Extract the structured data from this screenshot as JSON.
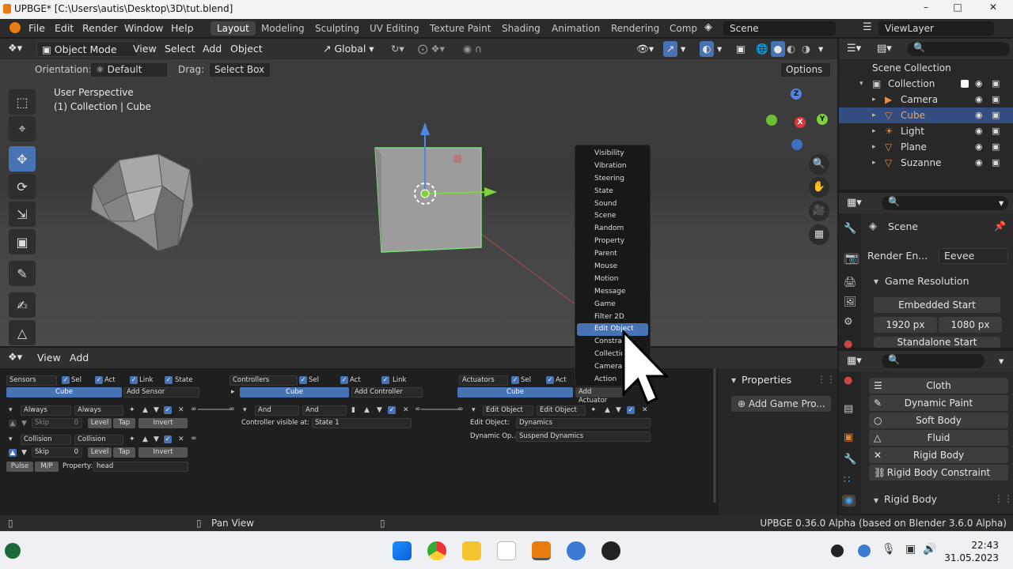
{
  "window": {
    "title": "UPBGE* [C:\\Users\\autis\\Desktop\\3D\\tut.blend]",
    "minimize": "–",
    "maximize": "□",
    "close": "✕"
  },
  "menus": [
    "File",
    "Edit",
    "Render",
    "Window",
    "Help"
  ],
  "workspaces": [
    "Layout",
    "Modeling",
    "Sculpting",
    "UV Editing",
    "Texture Paint",
    "Shading",
    "Animation",
    "Rendering",
    "Comp"
  ],
  "scene_name": "Scene",
  "view_layer": "ViewLayer",
  "viewport_header": {
    "mode": "Object Mode",
    "items": [
      "View",
      "Select",
      "Add",
      "Object"
    ],
    "transform": "Global",
    "orientation_label": "Orientation:",
    "orientation_value": "Default",
    "drag_label": "Drag:",
    "drag_value": "Select Box",
    "options": "Options"
  },
  "viewport": {
    "perspective": "User Perspective",
    "collection_info": "(1) Collection | Cube",
    "gizmo": {
      "z": "Z",
      "x": "X",
      "y": "Y"
    }
  },
  "context_menu": {
    "items": [
      "Visibility",
      "Vibration",
      "Steering",
      "State",
      "Sound",
      "Scene",
      "Random",
      "Property",
      "Parent",
      "Mouse",
      "Motion",
      "Message",
      "Game",
      "Filter 2D",
      "Edit Object",
      "Constraint",
      "Collection",
      "Camera",
      "Action"
    ],
    "highlighted": "Edit Object"
  },
  "logic_editor": {
    "header": {
      "view": "View",
      "add": "Add"
    },
    "sensors": {
      "title": "Sensors",
      "sel": "Sel",
      "act": "Act",
      "link": "Link",
      "state": "State",
      "object": "Cube",
      "add": "Add Sensor",
      "items": [
        {
          "type": "Always",
          "name": "Always",
          "skip_label": "Skip",
          "skip": "0",
          "level": "Level",
          "tap": "Tap",
          "invert": "Invert"
        },
        {
          "type": "Collision",
          "name": "Collision",
          "skip_label": "Skip",
          "skip": "0",
          "level": "Level",
          "tap": "Tap",
          "invert": "Invert",
          "pulse": "Pulse",
          "mp": "M/P",
          "property_label": "Property:",
          "property": "head"
        }
      ]
    },
    "controllers": {
      "title": "Controllers",
      "sel": "Sel",
      "act": "Act",
      "link": "Link",
      "object": "Cube",
      "add": "Add Controller",
      "item": {
        "type": "And",
        "name": "And"
      },
      "visible_label": "Controller visible at:",
      "visible_value": "State 1"
    },
    "actuators": {
      "title": "Actuators",
      "sel": "Sel",
      "act": "Act",
      "object": "Cube",
      "add": "Add Actuator",
      "item": {
        "type": "Edit Object",
        "name": "Edit Object",
        "edit_label": "Edit Object:",
        "edit_value": "Dynamics",
        "dyn_label": "Dynamic Op...",
        "dyn_value": "Suspend Dynamics"
      }
    },
    "properties": {
      "title": "Properties",
      "add_button": "Add Game Pro..."
    }
  },
  "outliner": {
    "root": "Scene Collection",
    "rows": [
      {
        "name": "Collection",
        "icon": "collection-icon",
        "color": "#cccccc"
      },
      {
        "name": "Camera",
        "icon": "camera-icon",
        "color": "#e09050"
      },
      {
        "name": "Cube",
        "icon": "mesh-icon",
        "color": "#e09050",
        "selected": true
      },
      {
        "name": "Light",
        "icon": "light-icon",
        "color": "#e09050"
      },
      {
        "name": "Plane",
        "icon": "mesh-icon",
        "color": "#e09050"
      },
      {
        "name": "Suzanne",
        "icon": "mesh-icon",
        "color": "#e09050"
      }
    ]
  },
  "properties_panel": {
    "scene": "Scene",
    "render_engine_label": "Render En...",
    "render_engine": "Eevee",
    "section": "Game Resolution",
    "embedded_start": "Embedded Start",
    "res_x": "1920 px",
    "res_y": "1080 px",
    "standalone_start": "Standalone Start"
  },
  "physics_panel": {
    "buttons": [
      "Cloth",
      "Dynamic Paint",
      "Soft Body",
      "Fluid",
      "Rigid Body",
      "Rigid Body Constraint"
    ],
    "section": "Rigid Body"
  },
  "status_bar": {
    "pan": "Pan View",
    "version": "UPBGE 0.36.0 Alpha (based on Blender 3.6.0 Alpha)"
  },
  "taskbar": {
    "time": "22:43",
    "date": "31.05.2023"
  },
  "colors": {
    "accent": "#4772b3",
    "selection_outline": "#7cdc7c",
    "outliner_selected": "#334d80"
  }
}
